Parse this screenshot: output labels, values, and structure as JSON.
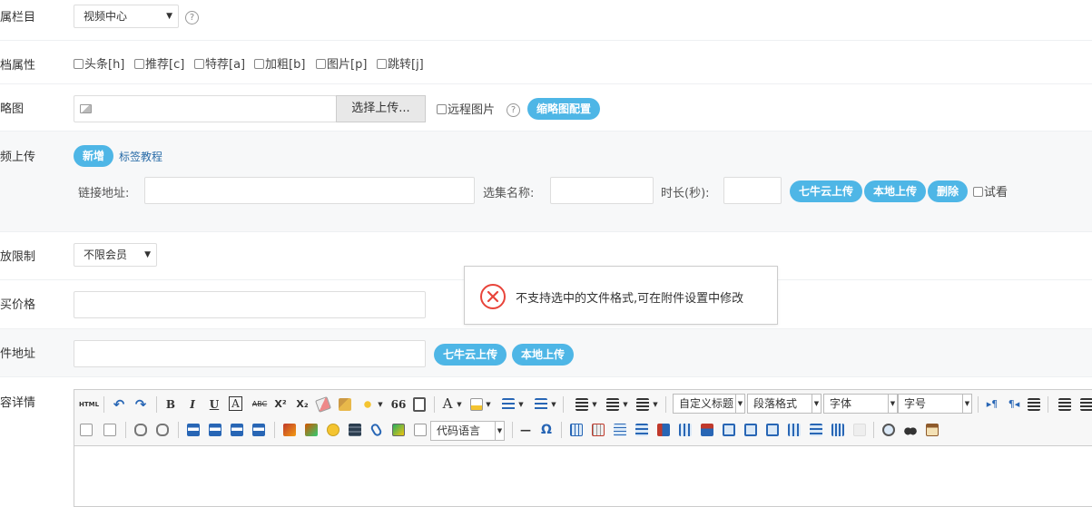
{
  "rows": {
    "column": {
      "label": "属栏目",
      "value": "视频中心"
    },
    "attrs": {
      "label": "档属性",
      "items": [
        "头条[h]",
        "推荐[c]",
        "特荐[a]",
        "加粗[b]",
        "图片[p]",
        "跳转[j]"
      ]
    },
    "thumb": {
      "label": "略图",
      "upload_btn": "选择上传...",
      "remote": "远程图片",
      "config_btn": "缩略图配置"
    },
    "video": {
      "label": "频上传",
      "add_btn": "新增",
      "tutorial": "标签教程",
      "url_label": "链接地址:",
      "name_label": "选集名称:",
      "duration_label": "时长(秒):",
      "qiniu_btn": "七牛云上传",
      "local_btn": "本地上传",
      "delete_btn": "删除",
      "preview": "试看"
    },
    "access": {
      "label": "放限制",
      "value": "不限会员"
    },
    "price": {
      "label": "买价格"
    },
    "file": {
      "label": "件地址",
      "qiniu_btn": "七牛云上传",
      "local_btn": "本地上传"
    },
    "detail": {
      "label": "容详情"
    }
  },
  "toast": {
    "message": "不支持选中的文件格式,可在附件设置中修改"
  },
  "editor": {
    "html_label": "HTML",
    "selects": [
      "自定义标题",
      "段落格式",
      "字体",
      "字号"
    ],
    "code_lang": "代码语言",
    "glyphs": {
      "bold": "B",
      "italic": "I",
      "underline": "U",
      "font_border": "A",
      "strike": "ABC",
      "sup": "X²",
      "sub": "X₂",
      "quote": "66",
      "forecolor": "A",
      "omega": "Ω",
      "hr": "—",
      "ltr": "▸¶",
      "rtl": "¶◂",
      "undo": "↶",
      "redo": "↷"
    },
    "accent_color": "#4eb6e6"
  }
}
